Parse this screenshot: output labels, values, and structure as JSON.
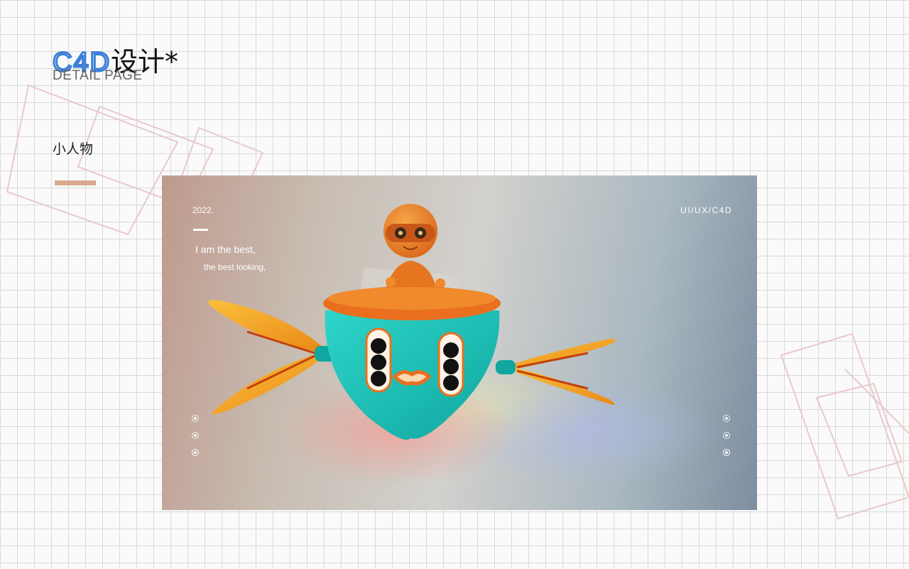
{
  "header": {
    "title_latin": "C4D",
    "title_cjk": "设计*",
    "subtitle": "DETAIL PAGE",
    "title_color": "#3d7fd6"
  },
  "section": {
    "label": "小人物",
    "accent_color": "#d9ab8e"
  },
  "hero": {
    "year": "2022.",
    "tag": "UI/UX/C4D",
    "headline": "I am the best,",
    "tagline": "the best looking,",
    "pager_left_count": 3,
    "pager_right_count": 3,
    "active_index": 2
  },
  "colors": {
    "body_teal": "#1bbdb5",
    "rim_orange": "#ea6f1f",
    "wing_yellow": "#f9ad25"
  }
}
